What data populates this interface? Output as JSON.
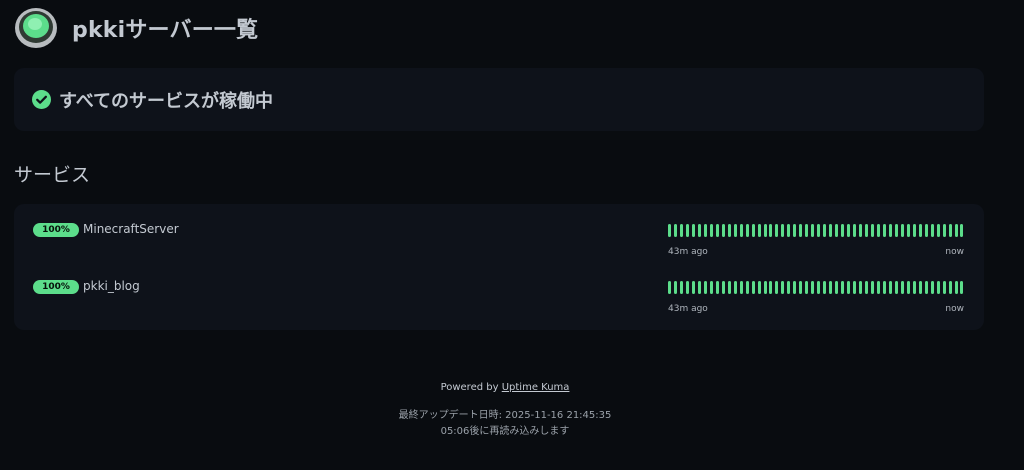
{
  "header": {
    "title": "pkkiサーバー一覧",
    "logo_icon": "uptime-kuma-logo-icon"
  },
  "status": {
    "text": "すべてのサービスが稼働中",
    "icon": "check-circle-icon",
    "color": "#5cdd8b"
  },
  "section": {
    "title": "サービス"
  },
  "services": [
    {
      "uptime": "100%",
      "name": "MinecraftServer",
      "time_start": "43m ago",
      "time_end": "now",
      "beats": 50
    },
    {
      "uptime": "100%",
      "name": "pkki_blog",
      "time_start": "43m ago",
      "time_end": "now",
      "beats": 50
    }
  ],
  "footer": {
    "powered_by": "Powered by",
    "powered_link": "Uptime Kuma",
    "last_updated": "最終アップデート日時: 2025-11-16 21:45:35",
    "reload": "05:06後に再読み込みします"
  },
  "colors": {
    "background": "#090c10",
    "card": "#0e121a",
    "accent": "#5cdd8b",
    "text": "#c3c9d1"
  }
}
